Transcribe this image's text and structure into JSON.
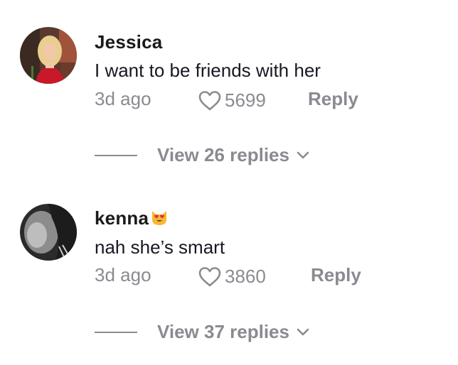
{
  "comments": [
    {
      "username": "Jessica",
      "text": "I want to be friends with her",
      "time": "3d ago",
      "likes": "5699",
      "reply_label": "Reply",
      "view_replies": "View 26 replies"
    },
    {
      "username": "kenna",
      "username_emoji": "heart-eyes-cat-emoji",
      "text": "nah she’s smart",
      "time": "3d ago",
      "likes": "3860",
      "reply_label": "Reply",
      "view_replies": "View 37 replies"
    }
  ],
  "colors": {
    "primary_text": "#161823",
    "secondary_text": "#8a8b91",
    "background": "#ffffff"
  }
}
